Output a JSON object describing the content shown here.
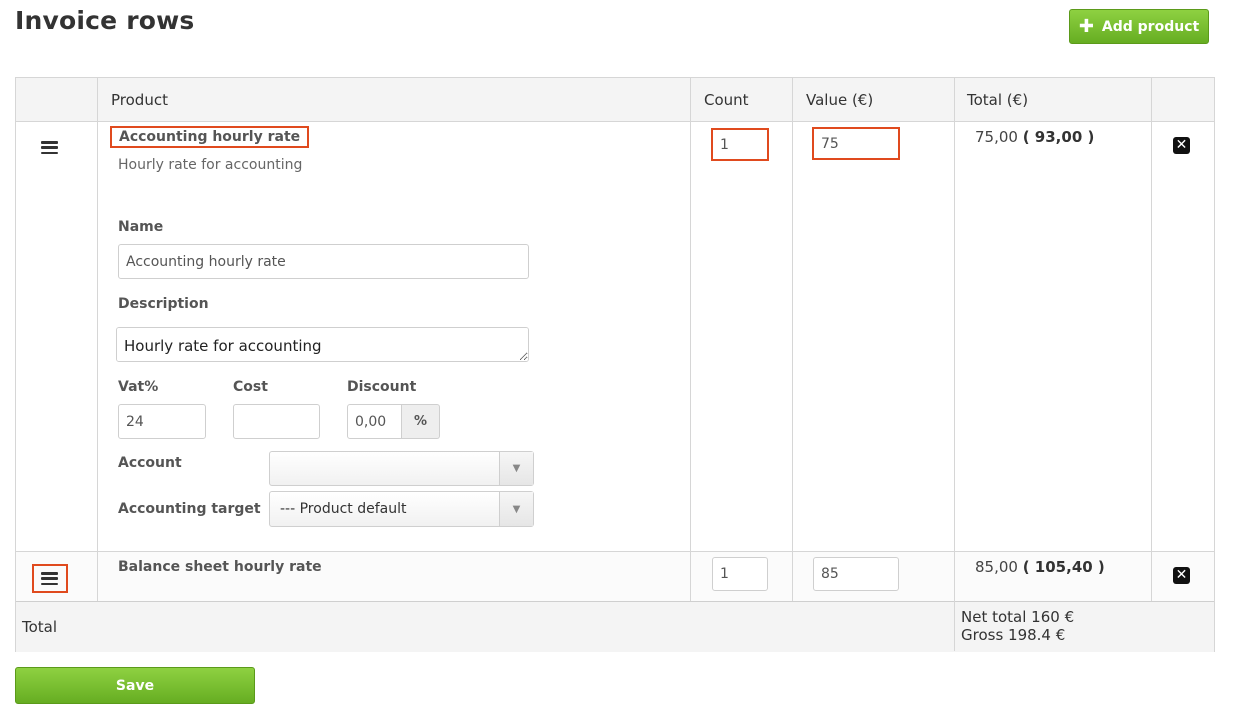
{
  "page": {
    "title": "Invoice rows"
  },
  "toolbar": {
    "add_product_label": "Add product"
  },
  "table": {
    "headers": {
      "product": "Product",
      "count": "Count",
      "value": "Value (€)",
      "total": "Total (€)"
    },
    "rows": [
      {
        "title": "Accounting hourly rate",
        "description": "Hourly rate for accounting",
        "count": "1",
        "value": "75",
        "total": "75,00",
        "gross": "( 93,00 )",
        "editor": {
          "name_label": "Name",
          "name_value": "Accounting hourly rate",
          "description_label": "Description",
          "description_value": "Hourly rate for accounting",
          "vat_label": "Vat%",
          "vat_value": "24",
          "cost_label": "Cost",
          "cost_value": "",
          "discount_label": "Discount",
          "discount_value": "0,00",
          "discount_unit": "%",
          "account_label": "Account",
          "account_value": "",
          "target_label": "Accounting target",
          "target_value": "--- Product default"
        }
      },
      {
        "title": "Balance sheet hourly rate",
        "count": "1",
        "value": "85",
        "total": "85,00",
        "gross": "( 105,40 )"
      }
    ],
    "footer": {
      "label": "Total",
      "net": "Net total 160 €",
      "gross": "Gross 198.4 €"
    }
  },
  "actions": {
    "save_label": "Save"
  },
  "colors": {
    "button_green": "#7cc233",
    "highlight": "#e04a1e"
  },
  "icons": {
    "drag": "hamburger-icon",
    "delete": "close-square-icon",
    "add": "plus-icon"
  }
}
